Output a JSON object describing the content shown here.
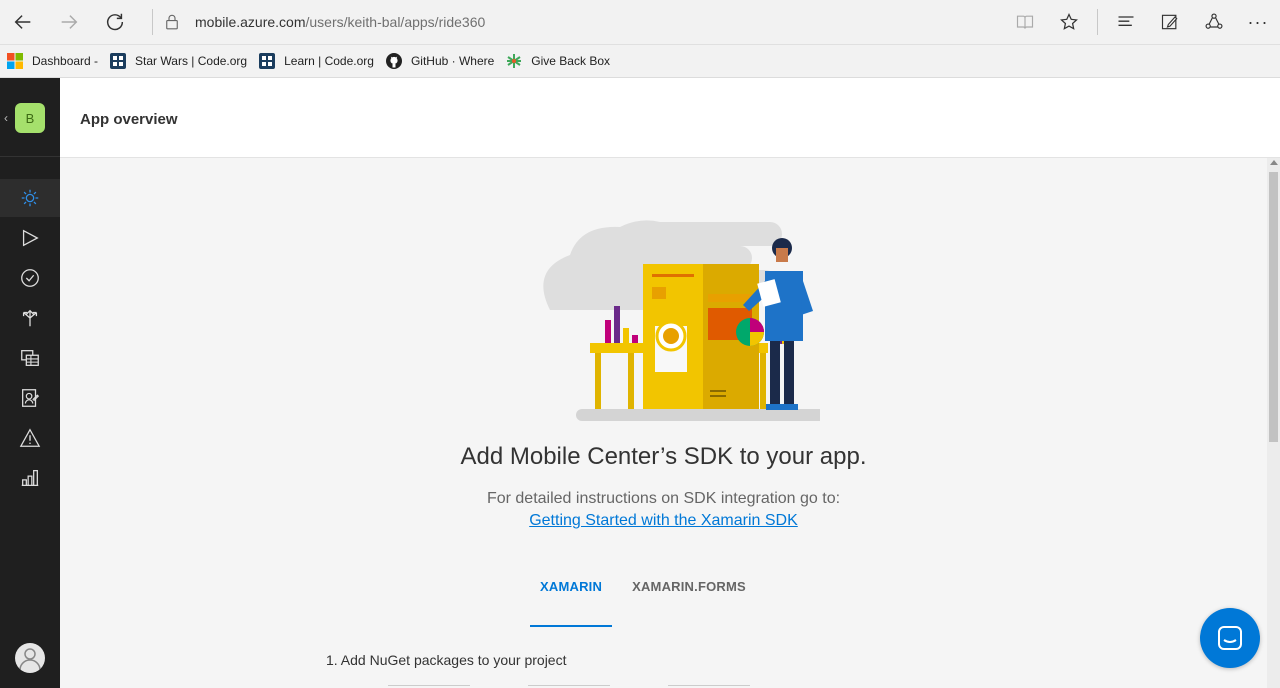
{
  "browser": {
    "url_host": "mobile.azure.com",
    "url_path": "/users/keith-bal/apps/ride360",
    "icons": [
      "back-icon",
      "forward-icon",
      "refresh-icon",
      "lock-icon",
      "reading-view-icon",
      "favorite-star-icon",
      "hub-icon",
      "web-note-icon",
      "share-icon",
      "more-icon"
    ],
    "more_label": "···"
  },
  "bookmarks": [
    {
      "label": "Dashboard -",
      "icon": "windows-logo-icon"
    },
    {
      "label": "Star Wars | Code.org",
      "icon": "code-org-icon"
    },
    {
      "label": "Learn | Code.org",
      "icon": "code-org-icon"
    },
    {
      "label": "GitHub · Where",
      "icon": "github-icon"
    },
    {
      "label": "Give Back Box",
      "icon": "give-back-box-icon"
    }
  ],
  "sidebar": {
    "back_glyph": "‹",
    "app_initial": "B",
    "app_color": "#a5e06c",
    "items": [
      {
        "name": "overview",
        "icon": "sun-icon",
        "active": true
      },
      {
        "name": "build",
        "icon": "play-icon"
      },
      {
        "name": "test",
        "icon": "check-circle-icon"
      },
      {
        "name": "distribute",
        "icon": "distribute-icon"
      },
      {
        "name": "tables",
        "icon": "tables-icon"
      },
      {
        "name": "identity",
        "icon": "identity-icon"
      },
      {
        "name": "crashes",
        "icon": "warning-icon"
      },
      {
        "name": "analytics",
        "icon": "bar-chart-icon"
      }
    ]
  },
  "header": {
    "title": "App overview"
  },
  "main": {
    "heading": "Add Mobile Center’s SDK to your app.",
    "subtext": "For detailed instructions on SDK integration go to:",
    "link_text": "Getting Started with the Xamarin SDK",
    "tabs": [
      {
        "label": "XAMARIN",
        "active": true
      },
      {
        "label": "XAMARIN.FORMS",
        "active": false
      }
    ],
    "step1": "1. Add NuGet packages to your project"
  },
  "colors": {
    "accent": "#0078d7",
    "sidebar_bg": "#1f1f1f",
    "main_bg": "#f5f5f5"
  }
}
